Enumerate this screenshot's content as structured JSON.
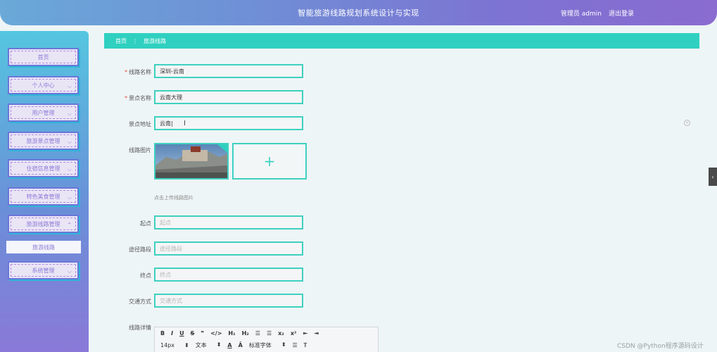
{
  "header": {
    "title": "智能旅游线路规划系统设计与实现",
    "user_label": "管理员 admin",
    "logout_label": "退出登录"
  },
  "sidebar": {
    "items": [
      {
        "label": "首页",
        "has_chevron": false
      },
      {
        "label": "个人中心",
        "has_chevron": true
      },
      {
        "label": "用户管理",
        "has_chevron": true
      },
      {
        "label": "旅游景点管理",
        "has_chevron": true
      },
      {
        "label": "住宿信息管理",
        "has_chevron": true
      },
      {
        "label": "特色美食管理",
        "has_chevron": true
      },
      {
        "label": "旅游线路管理",
        "has_chevron": true,
        "expanded": true
      },
      {
        "label": "系统管理",
        "has_chevron": true
      }
    ],
    "submenu": {
      "label": "旅游线路"
    }
  },
  "breadcrumb": {
    "home": "首页",
    "separator": "⋮",
    "current": "旅游线路"
  },
  "form": {
    "route_name": {
      "label": "线路名称",
      "value": "深圳-云南",
      "required": true
    },
    "scenic_name": {
      "label": "景点名称",
      "value": "云南大理",
      "required": true
    },
    "scenic_address": {
      "label": "景点地址",
      "value": "云南|",
      "required": false
    },
    "route_image": {
      "label": "线路图片",
      "hint": "点击上传线路图片"
    },
    "start": {
      "label": "起点",
      "placeholder": "起点"
    },
    "via": {
      "label": "途径路段",
      "placeholder": "途径路段"
    },
    "end": {
      "label": "终点",
      "placeholder": "终点"
    },
    "transport": {
      "label": "交通方式",
      "placeholder": "交通方式"
    },
    "detail": {
      "label": "线路详情"
    }
  },
  "editor": {
    "row1": [
      "B",
      "I",
      "U",
      "S",
      "❞",
      "</>",
      "H₁",
      "H₂",
      "☰",
      "☰",
      "x₂",
      "x²",
      "⇤",
      "⇥"
    ],
    "font_size": "14px",
    "text_style": "文本",
    "font_family": "标准字体"
  },
  "watermark": "CSDN @Python程序源码设计",
  "colors": {
    "accent": "#2fd0c0",
    "sidebar_border": "#6a77d8",
    "menu_text": "#8f7ad8"
  }
}
